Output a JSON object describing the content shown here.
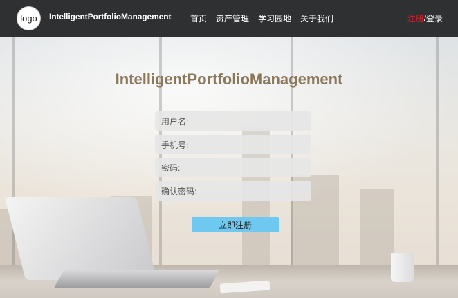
{
  "header": {
    "logo_text": "logo",
    "brand": "IntelligentPortfolioManagement",
    "nav": [
      "首页",
      "资产管理",
      "学习园地",
      "关于我们"
    ],
    "register_label": "注册",
    "separator": "/",
    "login_label": "登录"
  },
  "form": {
    "title": "IntelligentPortfolioManagement",
    "username_placeholder": "用户名:",
    "phone_placeholder": "手机号:",
    "password_placeholder": "密码:",
    "confirm_placeholder": "确认密码:",
    "submit_label": "立即注册"
  },
  "colors": {
    "header_bg": "#2f3032",
    "register_link": "#d4202c",
    "title": "#8b7759",
    "button": "#6fc8f0"
  }
}
